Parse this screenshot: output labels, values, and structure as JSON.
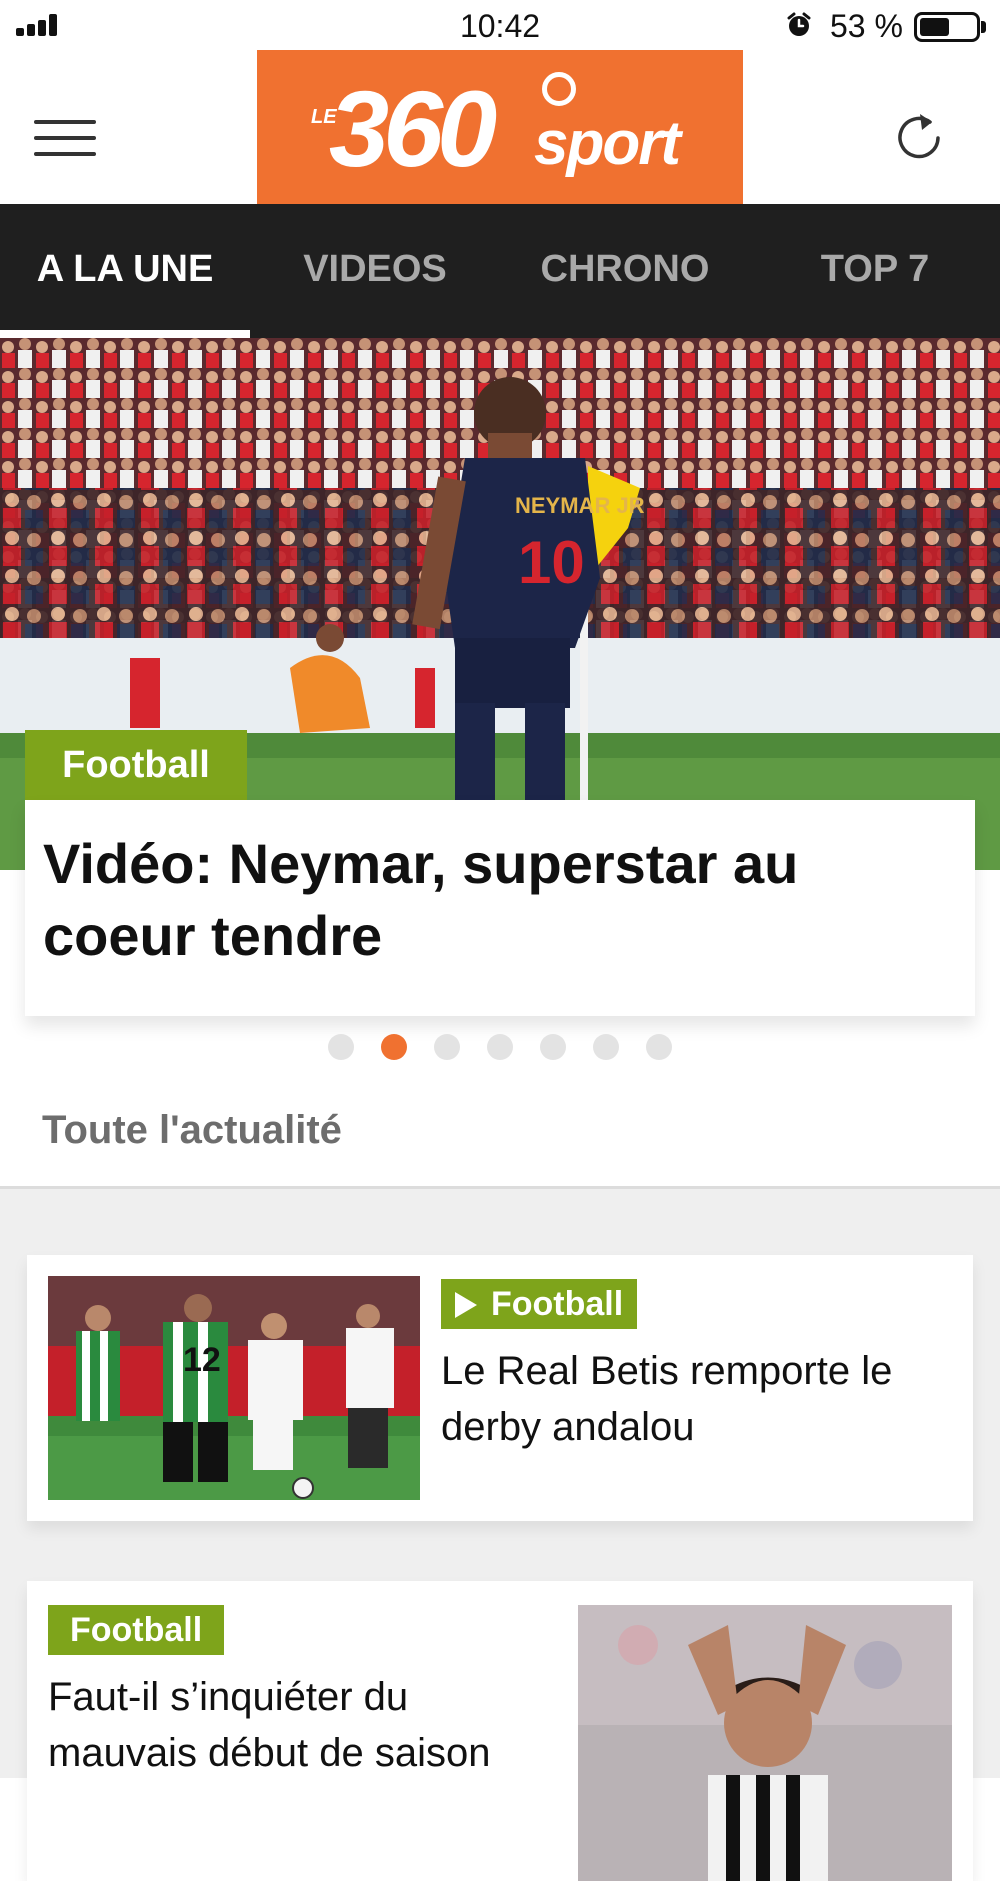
{
  "status_bar": {
    "time": "10:42",
    "battery_text": "53 %",
    "battery_level": 0.53,
    "icons": [
      "signal-icon",
      "alarm-icon",
      "battery-icon"
    ]
  },
  "header": {
    "logo": {
      "prefix": "LE",
      "number": "360",
      "suffix": "sport",
      "color": "#f07130"
    },
    "icons": [
      "menu-icon",
      "refresh-icon"
    ]
  },
  "tabs": [
    {
      "label": "A LA UNE",
      "active": true
    },
    {
      "label": "VIDEOS",
      "active": false
    },
    {
      "label": "CHRONO",
      "active": false
    },
    {
      "label": "TOP 7",
      "active": false
    }
  ],
  "hero": {
    "category": "Football",
    "title": "Vidéo: Neymar, superstar au coeur tendre",
    "jersey_name": "NEYMAR JR",
    "jersey_number": "10",
    "carousel": {
      "count": 7,
      "active_index": 1
    }
  },
  "section": {
    "title": "Toute l'actualité"
  },
  "articles": [
    {
      "category": "Football",
      "has_video": true,
      "title": "Le Real Betis remporte le derby andalou"
    },
    {
      "category": "Football",
      "has_video": false,
      "title": "Faut-il s’inquiéter du mauvais début de saison"
    }
  ],
  "colors": {
    "accent": "#f07130",
    "category_green": "#7ea41b",
    "tab_bar": "#1f1f1f"
  }
}
